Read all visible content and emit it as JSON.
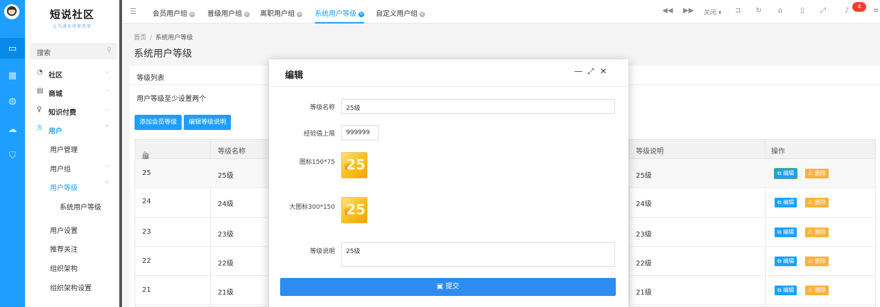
{
  "sidebar": {
    "logo_title": "短说社区",
    "logo_tagline": "让沟通去得更简单",
    "search_label": "搜索",
    "menu": [
      {
        "label": "社区",
        "icon": "chat-icon"
      },
      {
        "label": "商城",
        "icon": "shop-icon"
      },
      {
        "label": "知识付费",
        "icon": "bulb-icon"
      },
      {
        "label": "用户",
        "icon": "user-icon"
      }
    ],
    "user_submenu": [
      "用户管理",
      "用户组",
      "用户等级",
      "系统用户等级",
      "用户设置",
      "推荐关注",
      "组织架构",
      "组织架构设置"
    ]
  },
  "tabs": [
    "会员用户组",
    "普级用户组",
    "离职用户组",
    "系统用户等级",
    "自定义用户组"
  ],
  "topbar": {
    "close_label": "关闭",
    "notification_count": "4"
  },
  "breadcrumb": {
    "home": "首页",
    "sep": "/",
    "current": "系统用户等级"
  },
  "page_title": "系统用户等级",
  "card": {
    "header": "等级列表",
    "note": "用户等级至少设置两个",
    "btn_add": "添加会员等级",
    "btn_edit_desc": "编辑等级说明"
  },
  "table": {
    "col_id": "编号",
    "col_name": "等级名称",
    "col_desc": "等级说明",
    "col_ops": "操作",
    "edit_label": "编辑",
    "delete_label": "删除",
    "rows": [
      {
        "id": "25",
        "name": "25级",
        "desc": "25级"
      },
      {
        "id": "24",
        "name": "24级",
        "desc": "24级"
      },
      {
        "id": "23",
        "name": "23级",
        "desc": "23级"
      },
      {
        "id": "22",
        "name": "22级",
        "desc": "22级"
      },
      {
        "id": "21",
        "name": "21级",
        "desc": "21级"
      }
    ]
  },
  "modal": {
    "title": "编辑",
    "level_name_label": "等级名称",
    "level_name_value": "25级",
    "exp_label": "经验值上限",
    "exp_value": "999999",
    "icon_label": "图标150*75",
    "big_icon_label": "大图标300*150",
    "icon_number": "25",
    "desc_label": "等级说明",
    "desc_value": "25级",
    "submit_label": "提交"
  },
  "colors": {
    "accent": "#1e9fff",
    "warning": "#ffb13b",
    "badge": "#ff3b30"
  }
}
